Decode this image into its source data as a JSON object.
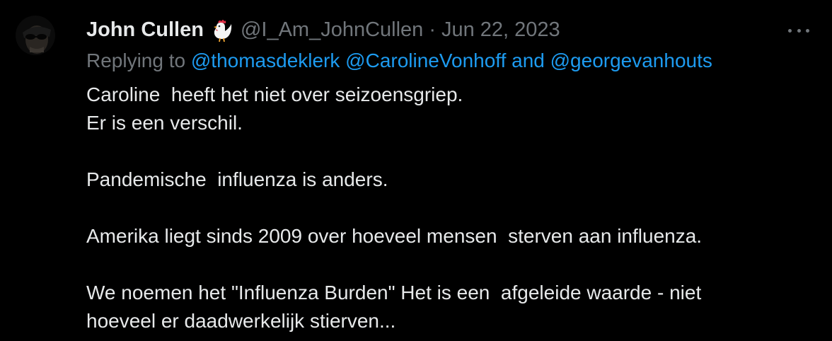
{
  "tweet": {
    "display_name": "John Cullen",
    "name_emoji": "rooster-emoji",
    "handle": "@I_Am_JohnCullen",
    "separator": "·",
    "date": "Jun 22, 2023",
    "replying_prefix": "Replying to",
    "mentions": [
      "@thomasdeklerk",
      "@CarolineVonhoff",
      "@georgevanhouts"
    ],
    "mention_joiner": "and",
    "body_lines": [
      "Caroline  heeft het niet over seizoensgriep.",
      "Er is een verschil.",
      "",
      "Pandemische  influenza is anders.",
      "",
      "Amerika liegt sinds 2009 over hoeveel mensen  sterven aan influenza.",
      "",
      "We noemen het \"Influenza Burden\" Het is een  afgeleide waarde - niet",
      "hoeveel er daadwerkelijk stierven..."
    ],
    "more_icon": "more-horizontal-icon"
  },
  "colors": {
    "background": "#000000",
    "text": "#e7e9ea",
    "muted": "#71767b",
    "link": "#1d9bf0"
  }
}
